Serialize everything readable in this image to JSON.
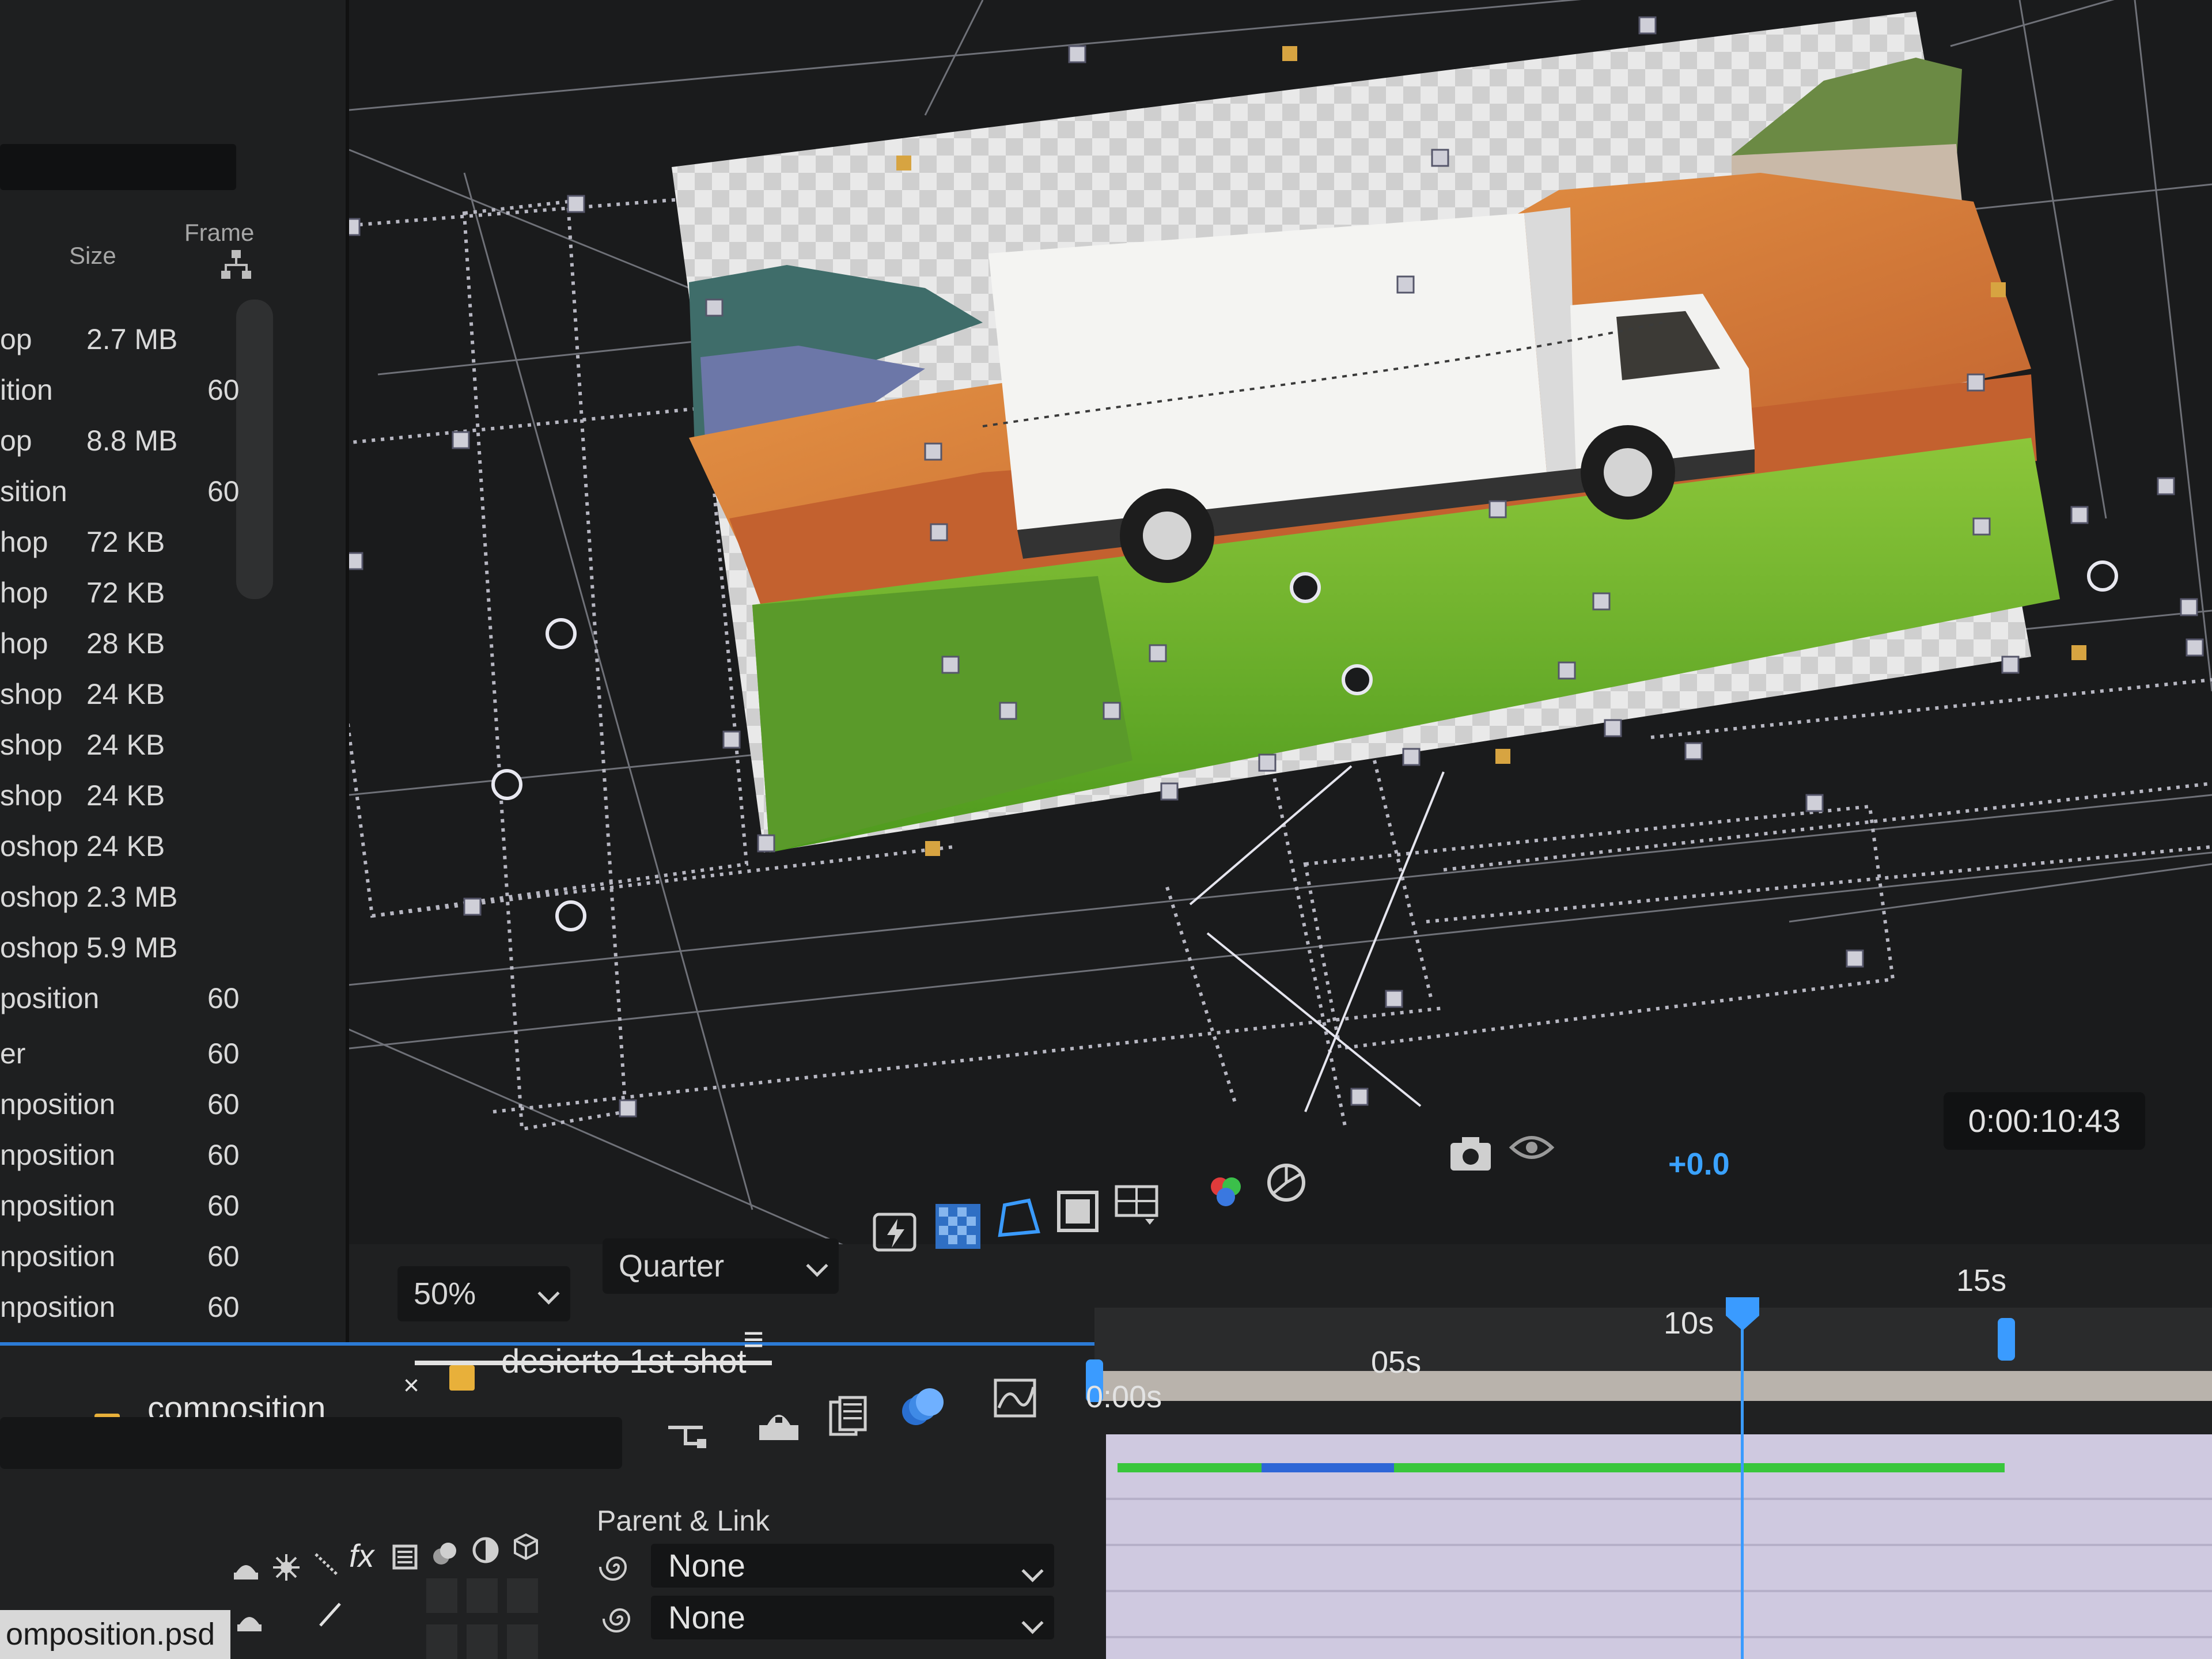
{
  "project": {
    "columns": {
      "size": "Size",
      "frame": "Frame"
    },
    "rows": [
      {
        "type": "op",
        "size": "2.7 MB",
        "frame": ""
      },
      {
        "type": "ition",
        "size": "",
        "frame": "60"
      },
      {
        "type": "op",
        "size": "8.8 MB",
        "frame": ""
      },
      {
        "type": "sition",
        "size": "",
        "frame": "60"
      },
      {
        "type": "hop",
        "size": "72 KB",
        "frame": ""
      },
      {
        "type": "hop",
        "size": "72 KB",
        "frame": ""
      },
      {
        "type": "hop",
        "size": "28 KB",
        "frame": ""
      },
      {
        "type": "shop",
        "size": "24 KB",
        "frame": ""
      },
      {
        "type": "shop",
        "size": "24 KB",
        "frame": ""
      },
      {
        "type": "shop",
        "size": "24 KB",
        "frame": ""
      },
      {
        "type": "oshop",
        "size": "24 KB",
        "frame": ""
      },
      {
        "type": "oshop",
        "size": "2.3 MB",
        "frame": ""
      },
      {
        "type": "oshop",
        "size": "5.9 MB",
        "frame": ""
      },
      {
        "type": "position",
        "size": "",
        "frame": "60"
      },
      {
        "type": "er",
        "size": "",
        "frame": "60"
      },
      {
        "type": "nposition",
        "size": "",
        "frame": "60"
      },
      {
        "type": "nposition",
        "size": "",
        "frame": "60"
      },
      {
        "type": "nposition",
        "size": "",
        "frame": "60"
      },
      {
        "type": "nposition",
        "size": "",
        "frame": "60"
      },
      {
        "type": "nposition",
        "size": "",
        "frame": "60"
      }
    ]
  },
  "viewer": {
    "zoom": "50%",
    "resolution": "Quarter",
    "exposure": "+0.0",
    "timecode": "0:00:10:43"
  },
  "timeline": {
    "tabs": [
      {
        "label": "composition",
        "swatch": "#e8b03a"
      },
      {
        "label": "desierto 1st shot",
        "swatch": "#e8b03a"
      }
    ],
    "close_glyph": "×",
    "menu_glyph": "≡",
    "ruler": {
      "start": "0:00s",
      "mark_5": "05s",
      "mark_10": "10s",
      "mark_15": "15s"
    },
    "current_time_s": 10.43,
    "parent_header": "Parent & Link",
    "parent_values": [
      "None",
      "None"
    ],
    "layer_name": "omposition.psd",
    "fx_label": "fx"
  },
  "colors": {
    "accent": "#2c7bd6",
    "playhead": "#3a9bff",
    "label_yellow": "#e8b03a",
    "green_bar": "#39c63c"
  },
  "icons": {
    "project": [
      "flowchart-icon"
    ],
    "toolbar": [
      "fast-previews-icon",
      "transparency-grid-icon",
      "mask-path-icon",
      "region-of-interest-icon",
      "guides-icon",
      "color-channels-icon",
      "exposure-icon",
      "camera-snapshot-icon",
      "show-snapshot-icon"
    ],
    "timeline": [
      "comp-flowchart-icon",
      "shy-icon",
      "frame-blending-icon",
      "motion-blur-icon",
      "graph-editor-icon",
      "pickwhip-icon"
    ]
  }
}
